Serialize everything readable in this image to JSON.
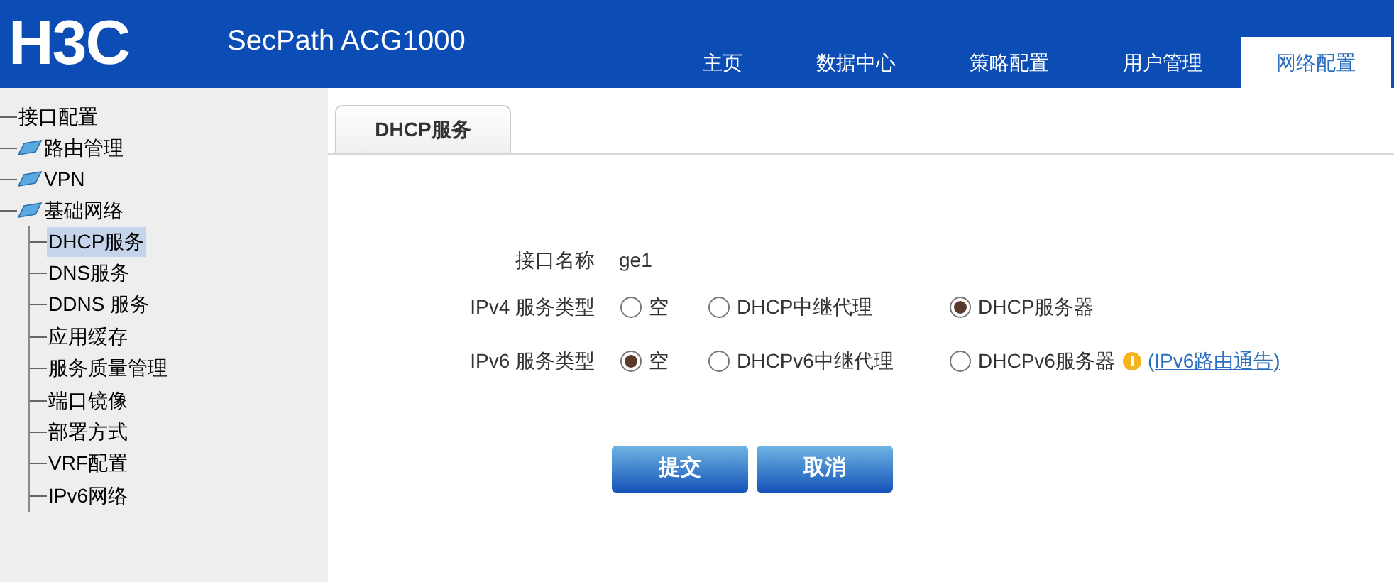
{
  "header": {
    "logo": "H3C",
    "product": "SecPath ACG1000"
  },
  "nav": [
    {
      "label": "主页",
      "selected": false
    },
    {
      "label": "数据中心",
      "selected": false
    },
    {
      "label": "策略配置",
      "selected": false
    },
    {
      "label": "用户管理",
      "selected": false
    },
    {
      "label": "网络配置",
      "selected": true
    }
  ],
  "sidebar": {
    "items": [
      {
        "label": "接口配置",
        "kind": "leaf",
        "selected": false
      },
      {
        "label": "路由管理",
        "kind": "folder",
        "selected": false
      },
      {
        "label": "VPN",
        "kind": "folder",
        "selected": false
      },
      {
        "label": "基础网络",
        "kind": "folder",
        "selected": false,
        "children": [
          {
            "label": "DHCP服务",
            "selected": true
          },
          {
            "label": "DNS服务",
            "selected": false
          },
          {
            "label": "DDNS 服务",
            "selected": false
          },
          {
            "label": "应用缓存",
            "selected": false
          },
          {
            "label": "服务质量管理",
            "selected": false
          },
          {
            "label": "端口镜像",
            "selected": false
          },
          {
            "label": "部署方式",
            "selected": false
          },
          {
            "label": "VRF配置",
            "selected": false
          },
          {
            "label": "IPv6网络",
            "selected": false
          }
        ]
      }
    ]
  },
  "tabs": [
    {
      "label": "DHCP服务",
      "selected": true
    }
  ],
  "form": {
    "interface": {
      "label": "接口名称",
      "value": "ge1"
    },
    "groups": [
      {
        "label": "IPv4 服务类型",
        "options": [
          {
            "label": "空",
            "selected": false
          },
          {
            "label": "DHCP中继代理",
            "selected": false
          },
          {
            "label": "DHCP服务器",
            "selected": true
          }
        ]
      },
      {
        "label": "IPv6 服务类型",
        "options": [
          {
            "label": "空",
            "selected": true
          },
          {
            "label": "DHCPv6中继代理",
            "selected": false
          },
          {
            "label": "DHCPv6服务器",
            "selected": false
          }
        ],
        "warning": true,
        "link": "(IPv6路由通告)"
      }
    ]
  },
  "buttons": [
    "提交",
    "取消"
  ]
}
